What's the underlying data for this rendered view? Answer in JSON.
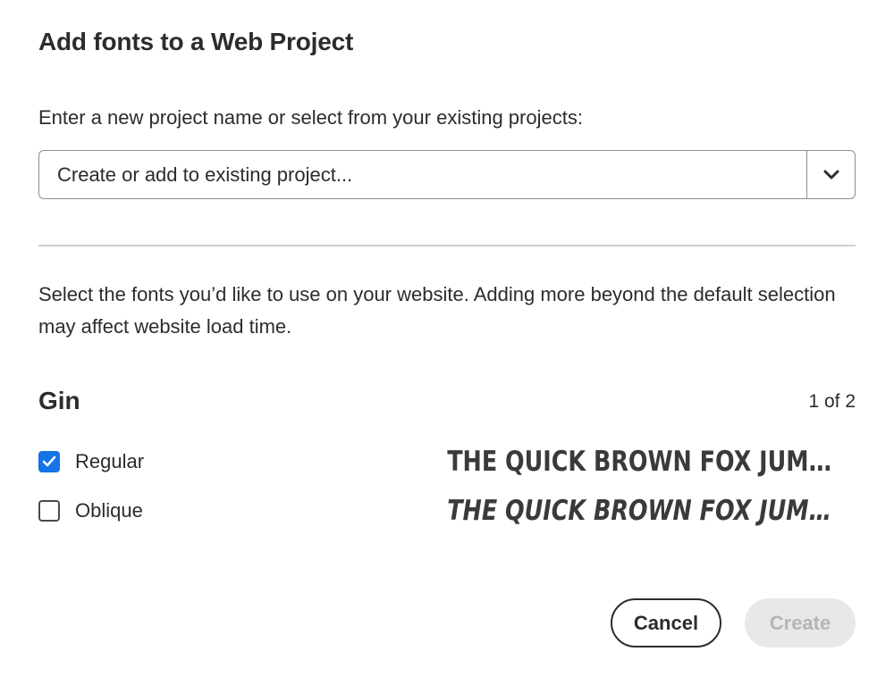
{
  "dialog": {
    "title": "Add fonts to a Web Project",
    "prompt": "Enter a new project name or select from your existing projects:",
    "project_input": {
      "placeholder": "Create or add to existing project...",
      "value": ""
    },
    "description": "Select the fonts you’d like to use on your website. Adding more beyond the default selection may affect website load time.",
    "font_family": {
      "name": "Gin",
      "counter": "1 of 2",
      "styles": [
        {
          "label": "Regular",
          "checked": true,
          "sample": "THE QUICK BROWN FOX JUMPS O…"
        },
        {
          "label": "Oblique",
          "checked": false,
          "sample": "THE QUICK BROWN FOX JUMPS O…"
        }
      ]
    },
    "buttons": {
      "cancel": "Cancel",
      "create": "Create",
      "create_enabled": false
    }
  },
  "colors": {
    "accent": "#1473e6",
    "text": "#2c2c2c",
    "disabled_bg": "#e8e8e8",
    "disabled_text": "#b5b5b5"
  },
  "icons": {
    "dropdown": "chevron-down-icon",
    "checked": "checkmark-icon"
  }
}
